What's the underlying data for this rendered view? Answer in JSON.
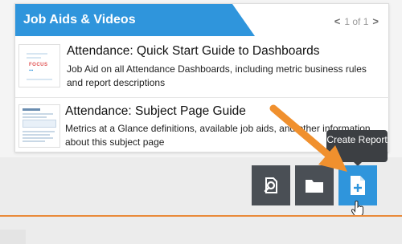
{
  "panel": {
    "title": "Job Aids & Videos",
    "pager": {
      "prev": "<",
      "text": "1 of 1",
      "next": ">"
    }
  },
  "items": [
    {
      "title": "Attendance: Quick Start Guide to Dashboards",
      "description": "Job Aid on all Attendance Dashboards, including metric business rules and report descriptions",
      "thumb_text": "FOCUS"
    },
    {
      "title": "Attendance: Subject Page Guide",
      "description": "Metrics at a Glance definitions, available job aids, and other information about this subject page"
    }
  ],
  "toolbar": {
    "tooltip": "Create Report",
    "buttons": [
      {
        "icon": "magnifier-icon"
      },
      {
        "icon": "folder-icon"
      },
      {
        "icon": "create-report-icon"
      }
    ]
  },
  "colors": {
    "accent": "#2f95dc",
    "dark_button": "#4a4f55",
    "arrow": "#f0902e",
    "tooltip": "#3c3f43"
  }
}
